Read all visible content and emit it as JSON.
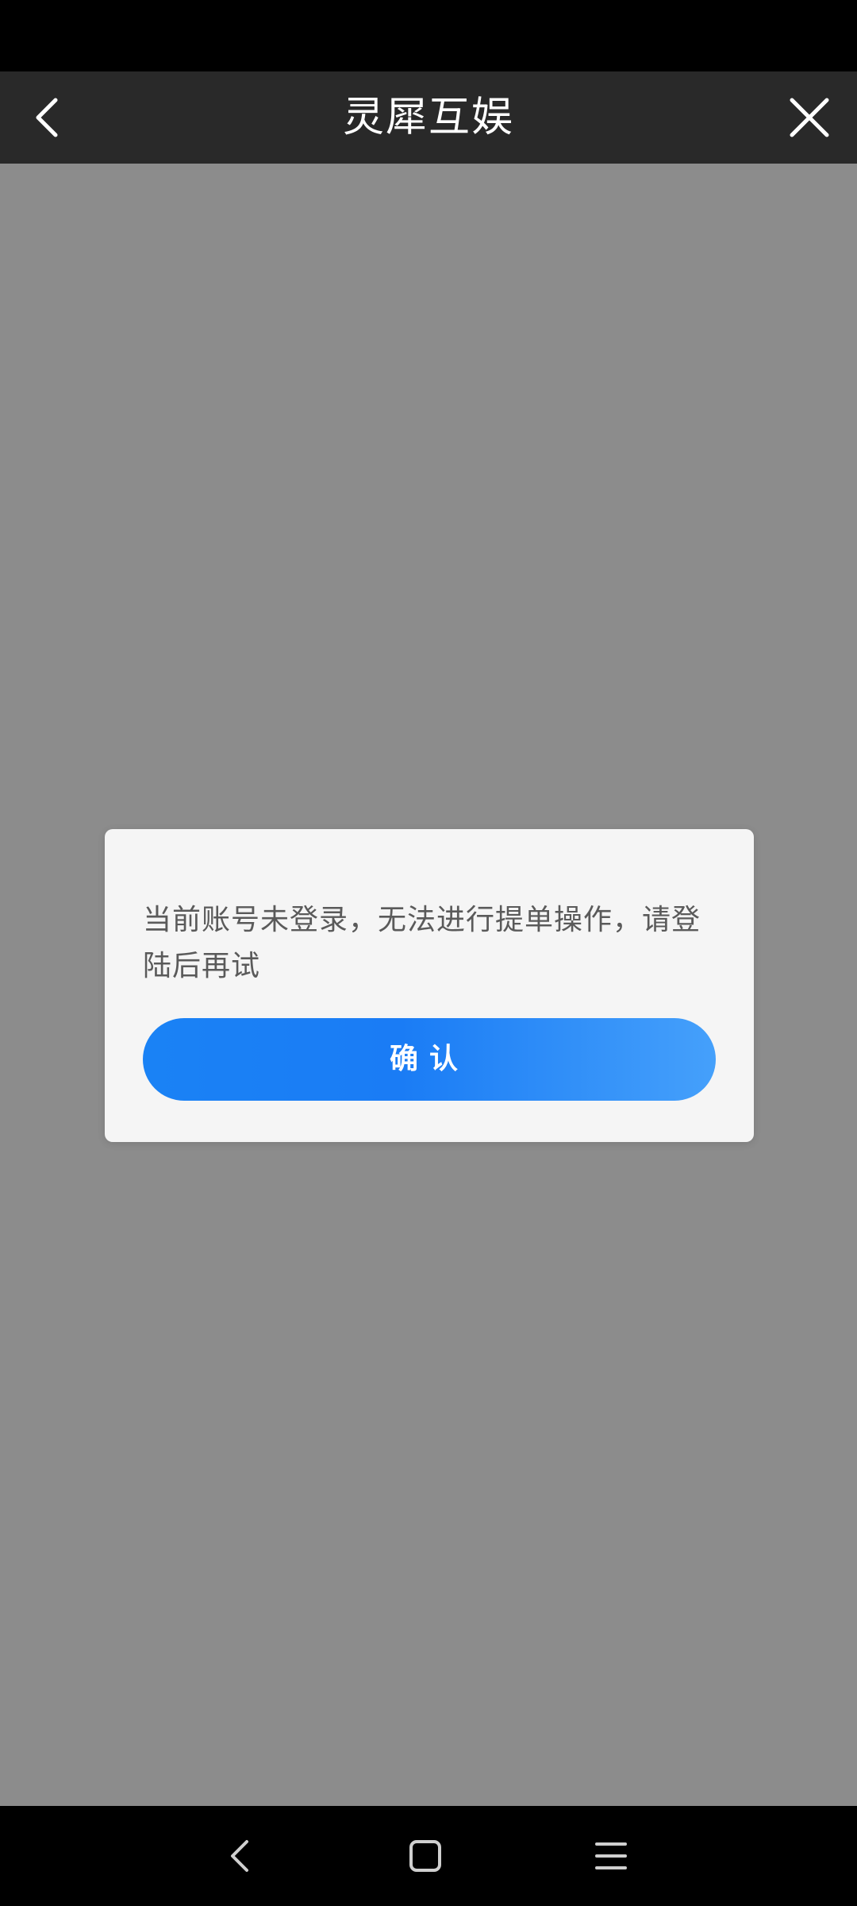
{
  "header": {
    "title": "灵犀互娱",
    "back_icon": "chevron-left-icon",
    "close_icon": "close-icon"
  },
  "dialog": {
    "message": "当前账号未登录，无法进行提单操作，请登陆后再试",
    "confirm_label": "确认",
    "confirm_color": "#1a82f5"
  },
  "nav_bar": {
    "back_icon": "nav-back-icon",
    "home_icon": "nav-home-icon",
    "menu_icon": "nav-recents-icon"
  },
  "colors": {
    "header_bg": "#292929",
    "overlay_bg": "#8c8c8c",
    "dialog_bg": "#f5f5f5"
  }
}
